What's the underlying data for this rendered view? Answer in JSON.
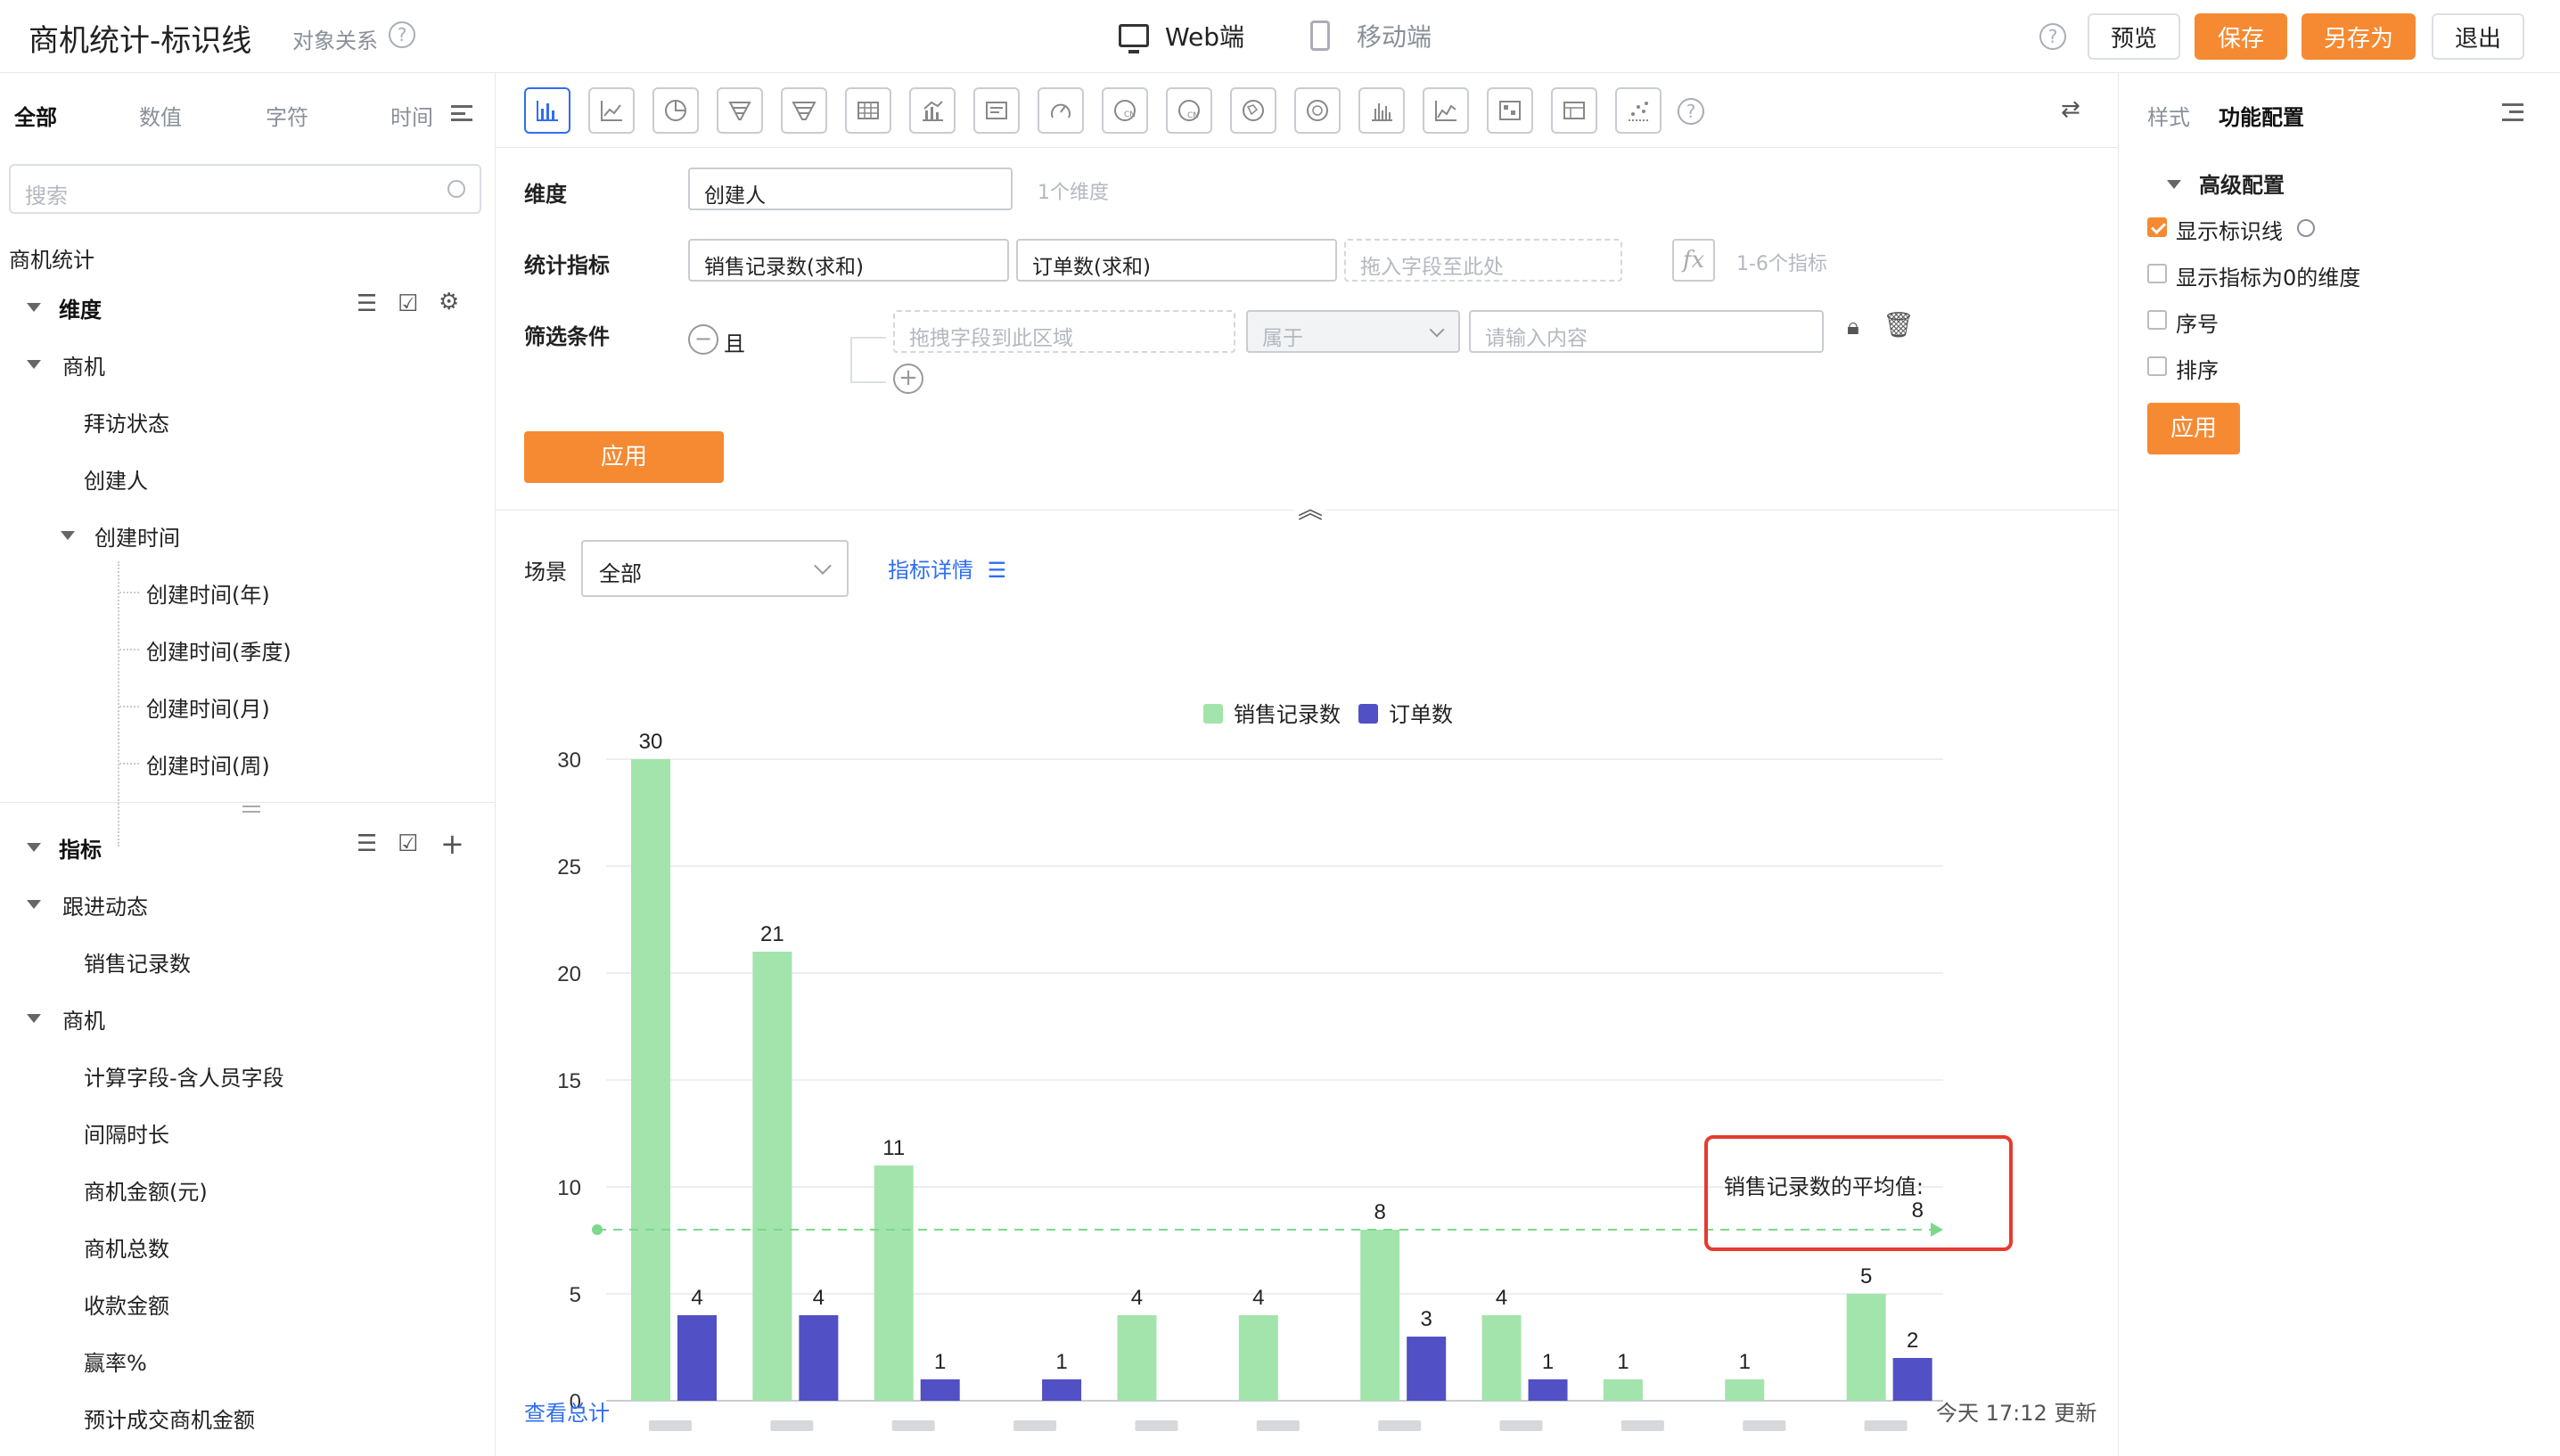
{
  "header": {
    "title": "商机统计-标识线",
    "relation": "对象关系",
    "web_label": "Web端",
    "mobile_label": "移动端",
    "preview": "预览",
    "save": "保存",
    "save_as": "另存为",
    "exit": "退出"
  },
  "left": {
    "tabs": [
      "全部",
      "数值",
      "字符",
      "时间"
    ],
    "search_placeholder": "搜索",
    "root": "商机统计",
    "dimension_title": "维度",
    "dimension_group": "商机",
    "dimension_items": [
      "拜访状态",
      "创建人",
      "创建时间"
    ],
    "time_items": [
      "创建时间(年)",
      "创建时间(季度)",
      "创建时间(月)",
      "创建时间(周)"
    ],
    "metric_title": "指标",
    "metric_group1": "跟进动态",
    "metric_group1_items": [
      "销售记录数"
    ],
    "metric_group2": "商机",
    "metric_group2_items": [
      "计算字段-含人员字段",
      "间隔时长",
      "商机金额(元)",
      "商机总数",
      "收款金额",
      "赢率%",
      "预计成交商机金额"
    ]
  },
  "config": {
    "dimension_label": "维度",
    "dimension_value": "创建人",
    "dimension_hint": "1个维度",
    "metric_label": "统计指标",
    "metric_values": [
      "销售记录数(求和)",
      "订单数(求和)"
    ],
    "metric_drop": "拖入字段至此处",
    "metric_fx": "fx",
    "metric_hint": "1-6个指标",
    "filter_label": "筛选条件",
    "filter_logic": "且",
    "filter_field": "拖拽字段到此区域",
    "filter_op": "属于",
    "filter_input": "请输入内容",
    "apply": "应用"
  },
  "scene": {
    "label": "场景",
    "value": "全部",
    "detail": "指标详情"
  },
  "footer": {
    "view_total": "查看总计",
    "updated": "今天 17:12 更新"
  },
  "right": {
    "tab_style": "样式",
    "tab_function": "功能配置",
    "section": "高级配置",
    "options": [
      {
        "label": "显示标识线",
        "checked": true
      },
      {
        "label": "显示指标为0的维度",
        "checked": false
      },
      {
        "label": "序号",
        "checked": false
      },
      {
        "label": "排序",
        "checked": false
      }
    ],
    "apply": "应用"
  },
  "colors": {
    "accent": "#f58a33",
    "link": "#2f6ef0",
    "series_green": "#a3e4ac",
    "series_blue": "#5150c4",
    "highlight": "#e63b2e"
  },
  "chart_data": {
    "type": "bar",
    "categories": [
      "",
      "",
      "",
      "",
      "",
      "",
      "",
      "",
      "",
      "",
      ""
    ],
    "series": [
      {
        "name": "销售记录数",
        "values": [
          30,
          21,
          11,
          0,
          4,
          4,
          8,
          4,
          1,
          1,
          5
        ]
      },
      {
        "name": "订单数",
        "values": [
          4,
          4,
          1,
          1,
          0,
          0,
          3,
          1,
          0,
          0,
          2
        ]
      }
    ],
    "ylim": [
      0,
      30
    ],
    "yticks": [
      0,
      5,
      10,
      15,
      20,
      25,
      30
    ],
    "grid": true,
    "legend": "top-center",
    "reference_line": {
      "value": 8,
      "label": "销售记录数的平均值:",
      "value_label": "8"
    }
  }
}
